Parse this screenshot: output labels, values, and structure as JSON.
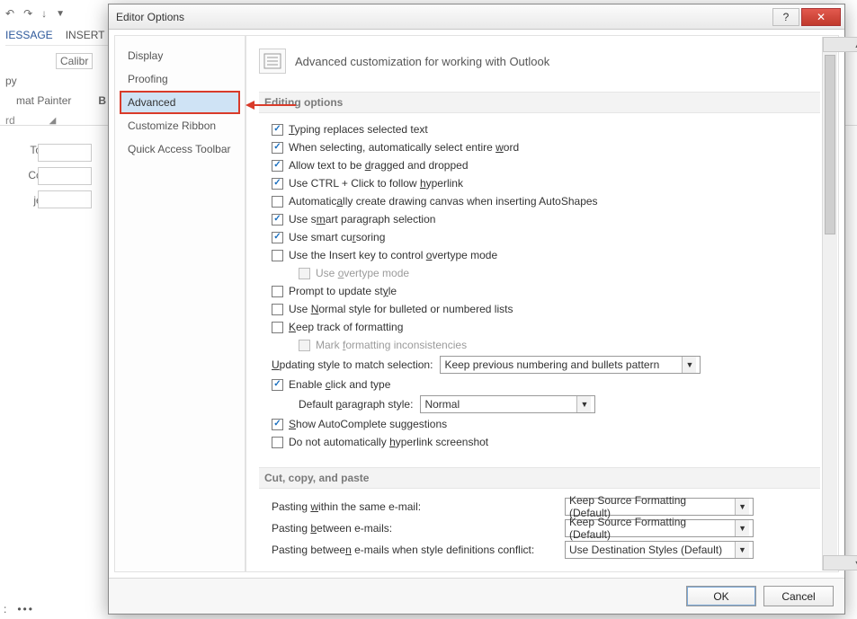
{
  "bg": {
    "tab_message": "IESSAGE",
    "tab_insert": "INSERT",
    "font_name": "Calibr",
    "paste_copy": "py",
    "format_painter": "mat Painter",
    "clipboard_group": "rd",
    "to": "To...",
    "cc": "Cc...",
    "subject": "ject",
    "bottom_colon": ":",
    "bottom_dots": "•••"
  },
  "dialog": {
    "title": "Editor Options",
    "help": "?",
    "close": "✕",
    "categories": [
      "Display",
      "Proofing",
      "Advanced",
      "Customize Ribbon",
      "Quick Access Toolbar"
    ],
    "heading": "Advanced customization for working with Outlook",
    "sections": {
      "editing": {
        "header": "Editing options",
        "opts": [
          {
            "label_pre": "",
            "u": "T",
            "label_post": "yping replaces selected text",
            "checked": true
          },
          {
            "label_pre": "When selecting, automatically select entire ",
            "u": "w",
            "label_post": "ord",
            "checked": true
          },
          {
            "label_pre": "Allow text to be ",
            "u": "d",
            "label_post": "ragged and dropped",
            "checked": true
          },
          {
            "label_pre": "Use CTRL + Click to follow ",
            "u": "h",
            "label_post": "yperlink",
            "checked": true
          },
          {
            "label_pre": "Automatic",
            "u": "a",
            "label_post": "lly create drawing canvas when inserting AutoShapes",
            "checked": false
          },
          {
            "label_pre": "Use s",
            "u": "m",
            "label_post": "art paragraph selection",
            "checked": true
          },
          {
            "label_pre": "Use smart cu",
            "u": "r",
            "label_post": "soring",
            "checked": true
          },
          {
            "label_pre": "Use the Insert key to control ",
            "u": "o",
            "label_post": "vertype mode",
            "checked": false
          },
          {
            "label_pre": "Use ",
            "u": "o",
            "label_post": "vertype mode",
            "checked": false,
            "indent": true,
            "disabled": true
          },
          {
            "label_pre": "Prompt to update st",
            "u": "y",
            "label_post": "le",
            "checked": false
          },
          {
            "label_pre": "Use ",
            "u": "N",
            "label_post": "ormal style for bulleted or numbered lists",
            "checked": false
          },
          {
            "label_pre": "",
            "u": "K",
            "label_post": "eep track of formatting",
            "checked": false
          },
          {
            "label_pre": "Mark ",
            "u": "f",
            "label_post": "ormatting inconsistencies",
            "checked": false,
            "indent": true,
            "disabled": true
          }
        ],
        "update_style_label_pre": "",
        "update_style_u": "U",
        "update_style_label_post": "pdating style to match selection:",
        "update_style_value": "Keep previous numbering and bullets pattern",
        "enable_ct_pre": "Enable ",
        "enable_ct_u": "c",
        "enable_ct_post": "lick and type",
        "enable_ct_checked": true,
        "default_ps_label_pre": "Default ",
        "default_ps_u": "p",
        "default_ps_label_post": "aragraph style:",
        "default_ps_value": "Normal",
        "autocomplete_pre": "",
        "autocomplete_u": "S",
        "autocomplete_post": "how AutoComplete suggestions",
        "autocomplete_checked": true,
        "hyperlink_ss_pre": "Do not automatically ",
        "hyperlink_ss_u": "h",
        "hyperlink_ss_post": "yperlink screenshot",
        "hyperlink_ss_checked": false
      },
      "paste": {
        "header": "Cut, copy, and paste",
        "rows": [
          {
            "label_pre": "Pasting ",
            "u": "w",
            "label_post": "ithin the same e-mail:",
            "value": "Keep Source Formatting (Default)"
          },
          {
            "label_pre": "Pasting ",
            "u": "b",
            "label_post": "etween e-mails:",
            "value": "Keep Source Formatting (Default)"
          },
          {
            "label_pre": "Pasting betwee",
            "u": "n",
            "label_post": " e-mails when style definitions conflict:",
            "value": "Use Destination Styles (Default)"
          }
        ]
      }
    },
    "buttons": {
      "ok": "OK",
      "cancel": "Cancel"
    }
  }
}
